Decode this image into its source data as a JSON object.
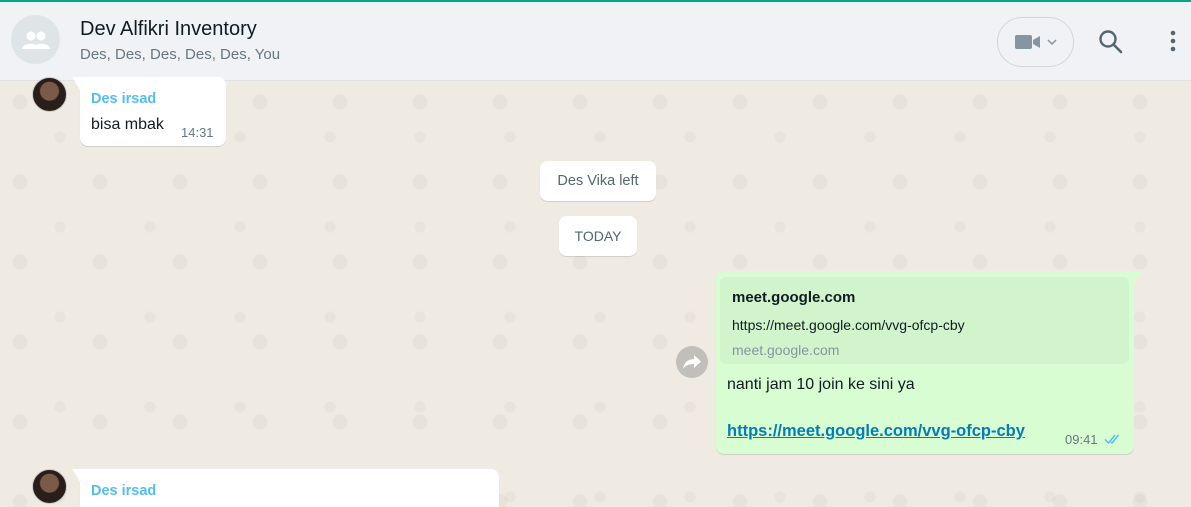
{
  "header": {
    "title": "Dev Alfikri Inventory",
    "members": "Des, Des, Des, Des, Des, You",
    "avatar_icon": "group-icon",
    "video_icon": "video-call-icon",
    "search_icon": "search-icon",
    "menu_icon": "kebab-menu-icon"
  },
  "messages": {
    "first": {
      "sender": "Des irsad",
      "text": "bisa mbak",
      "time": "14:31"
    },
    "system_left": "Des Vika left",
    "date_divider": "TODAY",
    "outgoing": {
      "preview_title": "meet.google.com",
      "preview_url": "https://meet.google.com/vvg-ofcp-cby",
      "preview_domain": "meet.google.com",
      "text": "nanti jam 10 join ke sini ya",
      "link": "https://meet.google.com/vvg-ofcp-cby",
      "time": "09:41",
      "status": "read"
    },
    "last": {
      "sender": "Des irsad"
    }
  },
  "colors": {
    "accent": "#00a884",
    "outgoing_bubble": "#d9fdd3",
    "sender_name": "#53bdeb",
    "link": "#027eb5",
    "read_ticks": "#53bdeb"
  }
}
